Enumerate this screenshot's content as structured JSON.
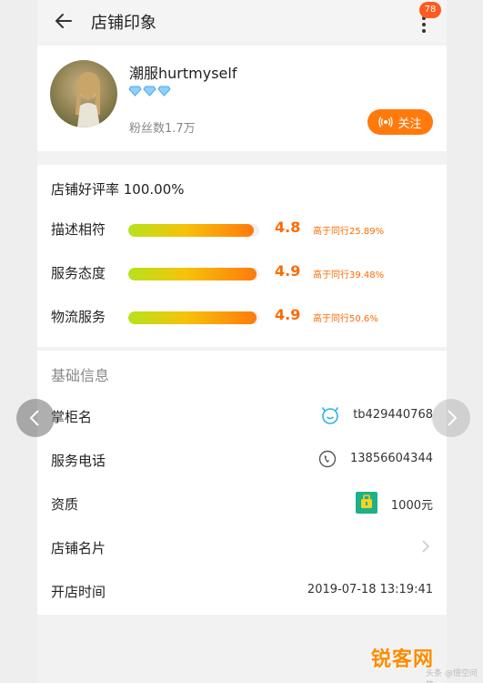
{
  "header": {
    "title": "店铺印象",
    "badge_count": "78"
  },
  "shop": {
    "name": "潮服hurtmyself",
    "diamond_count": 3,
    "fans": "粉丝数1.7万",
    "follow_label": "关注"
  },
  "rating": {
    "title": "店铺好评率 100.00%",
    "items": [
      {
        "label": "描述相符",
        "score": "4.8",
        "compare": "高于同行25.89%",
        "fill_fraction": 0.96
      },
      {
        "label": "服务态度",
        "score": "4.9",
        "compare": "高于同行39.48%",
        "fill_fraction": 0.98
      },
      {
        "label": "物流服务",
        "score": "4.9",
        "compare": "高于同行50.6%",
        "fill_fraction": 0.98
      }
    ]
  },
  "info": {
    "title": "基础信息",
    "rows": [
      {
        "label": "掌柜名",
        "value": "tb429440768",
        "icon": "wangwang-icon"
      },
      {
        "label": "服务电话",
        "value": "13856604344",
        "icon": "phone-icon"
      },
      {
        "label": "资质",
        "value": "1000元",
        "icon": "deposit-icon"
      },
      {
        "label": "店铺名片",
        "value": "",
        "icon": "chevron-right-icon"
      },
      {
        "label": "开店时间",
        "value": "2019-07-18 13:19:41",
        "icon": ""
      }
    ]
  },
  "watermark": {
    "main": "锐客网",
    "sub": "头条 @悟空问答"
  },
  "colors": {
    "accent": "#ff7a0c",
    "score": "#ff6a00",
    "badge": "#ff5a1f"
  }
}
